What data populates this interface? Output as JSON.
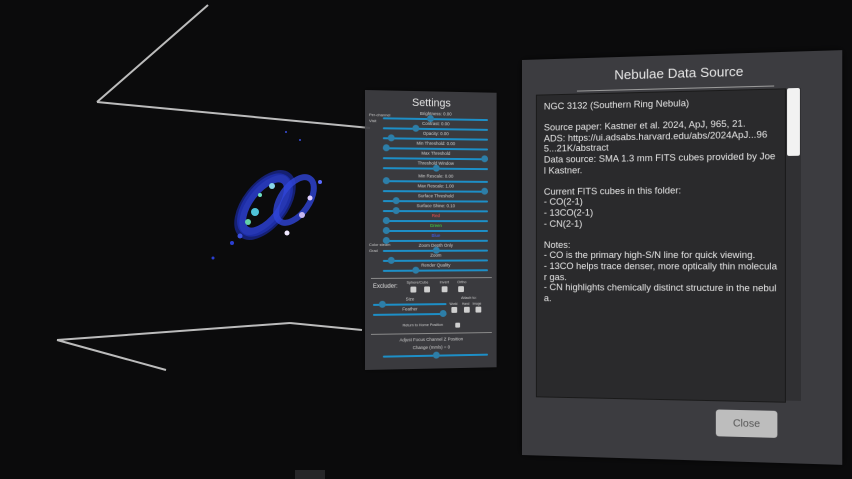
{
  "settings": {
    "title": "Settings",
    "sliders": [
      {
        "label": "Brightness: 0.00",
        "value": 0.45
      },
      {
        "label": "Contrast: 0.00",
        "value": 0.3
      },
      {
        "label": "Opacity: 0.00",
        "value": 0.05
      },
      {
        "label": "Min Threshold: 0.00",
        "value": 0.0
      },
      {
        "label": "Max Threshold",
        "value": 1.0
      },
      {
        "label": "Threshold Window",
        "value": 0.5
      },
      {
        "label": "Min Rescale: 0.00",
        "value": 0.0
      },
      {
        "label": "Max Rescale: 1.00",
        "value": 1.0
      },
      {
        "label": "Surface Threshold",
        "value": 0.1
      },
      {
        "label": "Surface Shine: 0.10",
        "value": 0.1
      },
      {
        "label": "Red",
        "value": 0.0
      },
      {
        "label": "Green",
        "value": 0.0
      },
      {
        "label": "Blue",
        "value": 0.0
      }
    ],
    "side_labels": {
      "top_left": "Per-channel",
      "top_left2": "Visit",
      "mid_left": "Color steam",
      "mid_left2": "Grad"
    },
    "lower_sliders": [
      {
        "label": "Zoom Depth Only",
        "value": 0.5
      },
      {
        "label": "Zoom",
        "value": 0.05
      },
      {
        "label": "Render Quality",
        "value": 0.3
      }
    ],
    "excluder": {
      "label": "Excluder:",
      "options": [
        "Sphere/Cube",
        "Invert",
        "Ortho"
      ],
      "attach_to": "Attach to:",
      "attach_options": [
        "World",
        "Hand",
        "Image"
      ],
      "size_label": "Size",
      "feather_label": "Feather",
      "return_label": "Return to Home Position"
    },
    "focus": {
      "label": "Adjust Focus Channel Z Position",
      "change_label": "Change (mmls) = 0",
      "value": 0.5
    }
  },
  "dialog": {
    "title": "Nebulae Data Source",
    "body": "NGC 3132 (Southern Ring Nebula)\n\nSource paper: Kastner et al. 2024, ApJ, 965, 21.\nADS: https://ui.adsabs.harvard.edu/abs/2024ApJ...965...21K/abstract\nData source: SMA 1.3 mm FITS cubes provided by Joel Kastner.\n\nCurrent FITS cubes in this folder:\n- CO(2-1)\n- 13CO(2-1)\n- CN(2-1)\n\nNotes:\n- CO is the primary high-S/N line for quick viewing.\n- 13CO helps trace denser, more optically thin molecular gas.\n- CN highlights chemically distinct structure in the nebula.",
    "close_label": "Close"
  },
  "colors": {
    "accent": "#1d8fc7",
    "panel": "#3e3e42",
    "nebula_blue": "#2b3fd1",
    "nebula_cyan": "#4fc3d8"
  }
}
